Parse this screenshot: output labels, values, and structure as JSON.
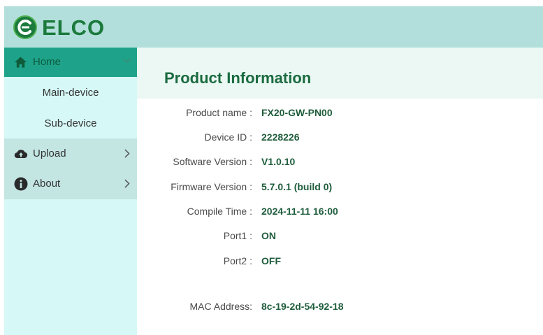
{
  "header": {
    "logo_text": "ELCO"
  },
  "sidebar": {
    "home_label": "Home",
    "sub_items": [
      "Main-device",
      "Sub-device"
    ],
    "upload_label": "Upload",
    "about_label": "About"
  },
  "main": {
    "title": "Product Information",
    "fields": [
      {
        "label": "Product name :",
        "value": "FX20-GW-PN00"
      },
      {
        "label": "Device ID :",
        "value": "2228226"
      },
      {
        "label": "Software Version :",
        "value": "V1.0.10"
      },
      {
        "label": "Firmware Version :",
        "value": "5.7.0.1 (build 0)"
      },
      {
        "label": "Compile Time :",
        "value": "2024-11-11 16:00"
      },
      {
        "label": "Port1 :",
        "value": "ON"
      },
      {
        "label": "Port2 :",
        "value": "OFF"
      },
      {
        "label": "MAC Address:",
        "value": "8c-19-2d-54-92-18"
      }
    ]
  },
  "colors": {
    "header_bg": "#b2dfdb",
    "sidebar_bg": "#d6f8f6",
    "active_nav": "#1ea38a",
    "brand_green": "#1b7a3c"
  },
  "icons": [
    "elco-logo-icon",
    "home-icon",
    "chevron-down-icon",
    "cloud-upload-icon",
    "info-icon",
    "chevron-right-icon"
  ]
}
